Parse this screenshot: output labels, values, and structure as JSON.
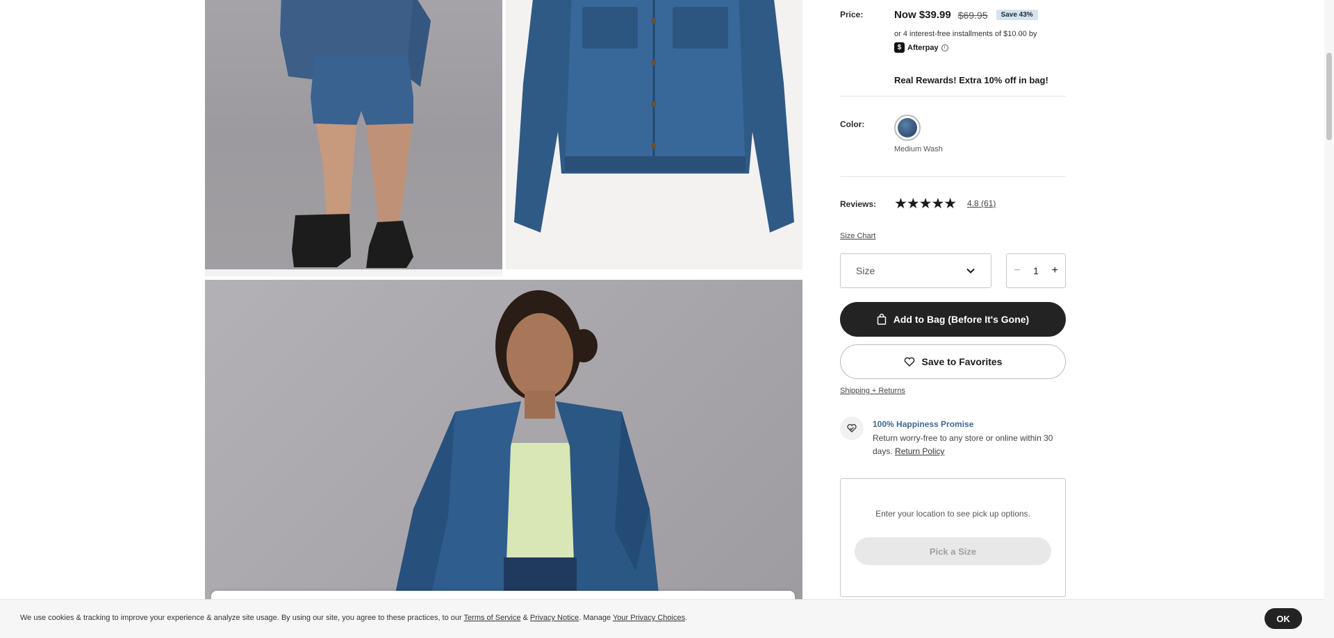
{
  "gallery": {
    "images": [
      {
        "name": "model-back-view",
        "alt": ""
      },
      {
        "name": "jacket-flat-view",
        "alt": ""
      },
      {
        "name": "model-front-view",
        "alt": ""
      }
    ]
  },
  "price": {
    "label": "Price:",
    "now": "Now $39.99",
    "was": "$69.95",
    "save_badge": "Save 43%",
    "installments": "or 4 interest-free installments of $10.00 by",
    "afterpay_brand": "Afterpay",
    "info_icon": "ⓘ",
    "rewards": "Real Rewards! Extra 10% off in bag!"
  },
  "color": {
    "label": "Color:",
    "selected_name": "Medium Wash",
    "swatch_color": "#3a5d85"
  },
  "reviews": {
    "label": "Reviews:",
    "stars_filled": 4.8,
    "stars_text": "★★★★★",
    "rating": "4.8",
    "count": "(61)"
  },
  "size_chart_link": "Size Chart",
  "size_select": {
    "placeholder": "Size"
  },
  "quantity": {
    "minus": "−",
    "value": "1",
    "plus": "+"
  },
  "buttons": {
    "add_to_bag": "Add to Bag (Before It's Gone)",
    "save_favorites": "Save to Favorites"
  },
  "shipping_link": "Shipping + Returns",
  "promise": {
    "title": "100% Happiness Promise",
    "text": "Return worry-free to any store or online within 30 days.",
    "link": "Return Policy"
  },
  "pickup": {
    "text": "Enter your location to see pick up options.",
    "button": "Pick a Size"
  },
  "cookie": {
    "text_before": "We use cookies & tracking to improve your experience & analyze site usage. By using our site, you agree to these practices, to our ",
    "terms": "Terms of Service",
    "amp": " & ",
    "privacy": "Privacy Notice",
    "mid": ". Manage ",
    "choices": "Your Privacy Choices",
    "end": ".",
    "ok": "OK"
  },
  "colors": {
    "primary_button": "#232323",
    "promise_title": "#3f6894",
    "save_badge_bg": "#d6e3ef"
  }
}
